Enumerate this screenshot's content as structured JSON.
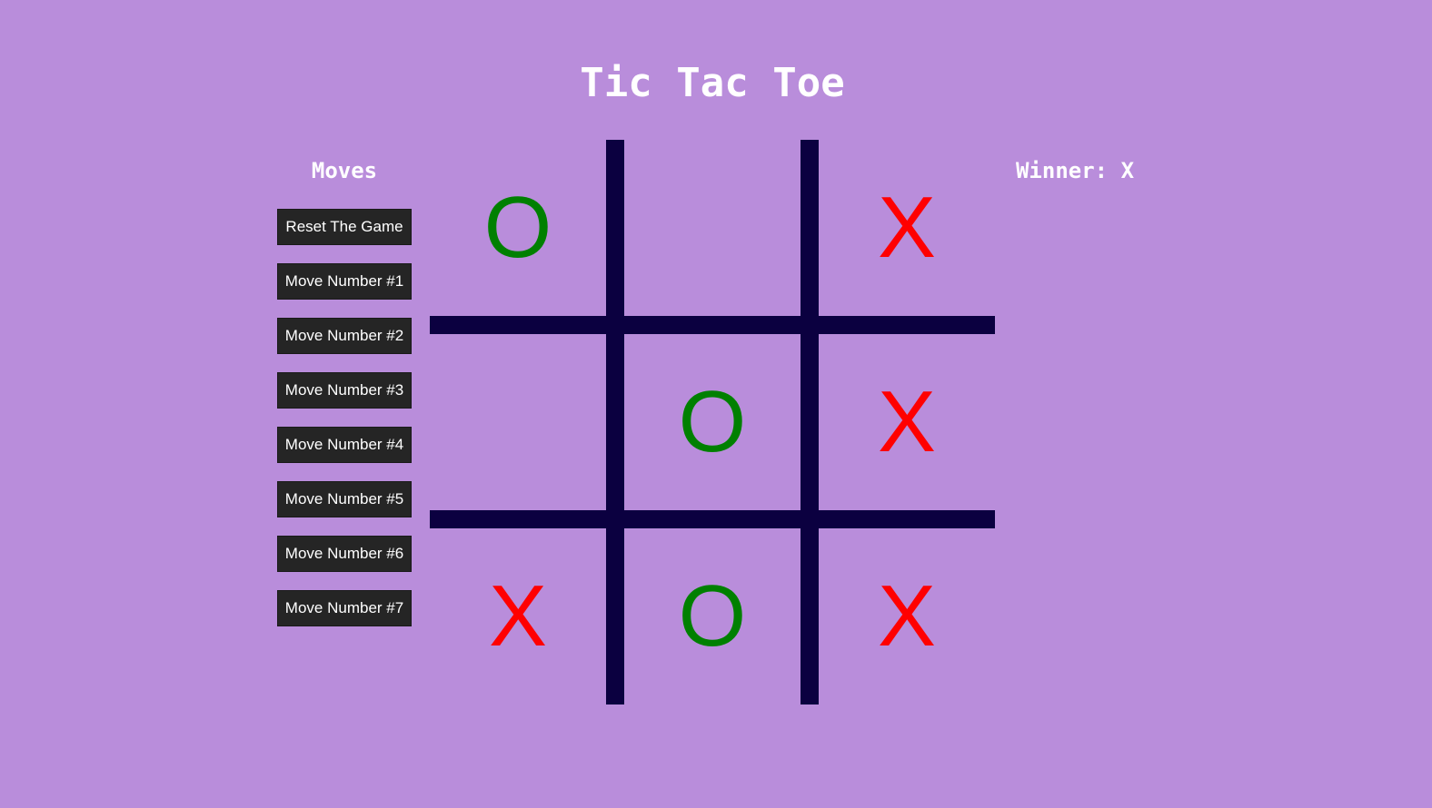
{
  "title": "Tic Tac Toe",
  "moves_heading": "Moves",
  "move_buttons": [
    "Reset The Game",
    "Move Number #1",
    "Move Number #2",
    "Move Number #3",
    "Move Number #4",
    "Move Number #5",
    "Move Number #6",
    "Move Number #7"
  ],
  "status": "Winner: X",
  "board": [
    "O",
    "",
    "X",
    "",
    "O",
    "X",
    "X",
    "O",
    "X"
  ],
  "colors": {
    "background": "#b98ddb",
    "grid": "#0b0040",
    "x_mark": "#ff0000",
    "o_mark": "#008000",
    "button_bg": "#252525",
    "text": "#ffffff"
  }
}
